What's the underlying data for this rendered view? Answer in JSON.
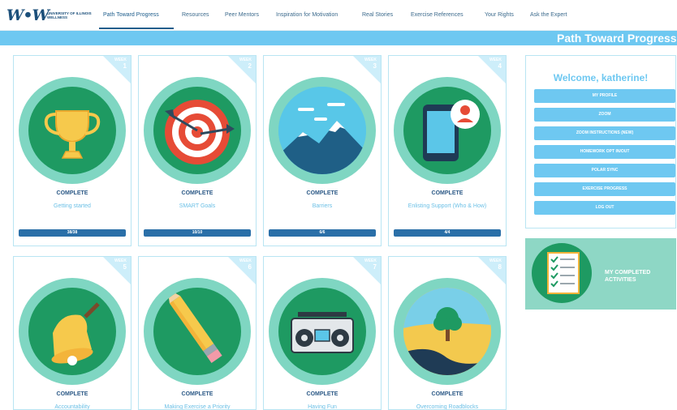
{
  "nav": {
    "logo": "W•W",
    "logo_sub": "University of Illinois Wellness",
    "items": [
      {
        "label": "Path Toward Progress"
      },
      {
        "label": "Resources"
      },
      {
        "label": "Peer Mentors"
      },
      {
        "label": "Inspiration for Motivation"
      },
      {
        "label": "Real Stories"
      },
      {
        "label": "Exercise References"
      },
      {
        "label": "Your Rights"
      },
      {
        "label": "Ask the Expert"
      }
    ]
  },
  "banner": {
    "title": "Path Toward Progress"
  },
  "week_prefix": "WEEK",
  "cards": [
    {
      "week": "1",
      "status": "COMPLETE",
      "title": "Getting started",
      "progress": "38/38",
      "icon": "trophy-icon"
    },
    {
      "week": "2",
      "status": "COMPLETE",
      "title": "SMART Goals",
      "progress": "10/10",
      "icon": "target-icon"
    },
    {
      "week": "3",
      "status": "COMPLETE",
      "title": "Barriers",
      "progress": "6/6",
      "icon": "mountain-icon"
    },
    {
      "week": "4",
      "status": "COMPLETE",
      "title": "Enlisting Support (Who & How)",
      "progress": "4/4",
      "icon": "phone-contact-icon"
    },
    {
      "week": "5",
      "status": "COMPLETE",
      "title": "Accountability",
      "progress": "",
      "icon": "bell-icon"
    },
    {
      "week": "6",
      "status": "COMPLETE",
      "title": "Making Exercise a Priority",
      "progress": "",
      "icon": "pencil-icon"
    },
    {
      "week": "7",
      "status": "COMPLETE",
      "title": "Having Fun",
      "progress": "",
      "icon": "boombox-icon"
    },
    {
      "week": "8",
      "status": "COMPLETE",
      "title": "Overcoming Roadblocks",
      "progress": "",
      "icon": "road-tree-icon"
    }
  ],
  "sidebar": {
    "welcome": "Welcome, katherine!",
    "buttons": [
      {
        "label": "MY PROFILE"
      },
      {
        "label": "ZOOM"
      },
      {
        "label": "ZOOM INSTRUCTIONS (NEW)"
      },
      {
        "label": "HOMEWORK OPT IN/OUT"
      },
      {
        "label": "POLAR SYNC"
      },
      {
        "label": "EXERCISE PROGRESS"
      },
      {
        "label": "LOG OUT"
      }
    ]
  },
  "activities": {
    "label": "MY COMPLETED ACTIVITIES",
    "icon": "checklist-icon"
  },
  "colors": {
    "banner": "#6ec8f1",
    "circle_outer": "#7fd6c2",
    "circle_inner": "#1e9a62",
    "progress": "#2a6fa8",
    "status": "#2d5a87",
    "card_title": "#6cc0e6"
  }
}
